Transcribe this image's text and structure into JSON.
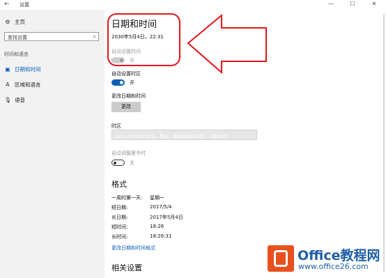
{
  "window": {
    "title": "设置",
    "back_glyph": "←",
    "minimize_glyph": "—",
    "maximize_glyph": "☐",
    "close_glyph": "✕"
  },
  "sidebar": {
    "home": {
      "label": "主页",
      "icon": "gear-icon"
    },
    "search": {
      "placeholder": "查找设置",
      "icon": "search-icon"
    },
    "section": "时间和语言",
    "items": [
      {
        "label": "日期和时间",
        "icon": "calendar-clock-icon",
        "active": true
      },
      {
        "label": "区域和语言",
        "icon": "region-language-icon",
        "active": false
      },
      {
        "label": "语音",
        "icon": "microphone-icon",
        "active": false
      }
    ]
  },
  "main": {
    "title": "日期和时间",
    "datetime": "2030年5月4日，22:31",
    "auto_time": {
      "label": "自动设置时间",
      "state": "开",
      "enabled": false
    },
    "auto_timezone": {
      "label": "自动设置时区",
      "state": "开",
      "on": true
    },
    "change": {
      "label": "更改日期和时间",
      "button": "更改"
    },
    "timezone": {
      "label": "时区",
      "value": "(UTC+08:00) 北京，重庆，香港特别行政区，乌鲁木齐"
    },
    "dst": {
      "label": "自动调整夏令时",
      "state": "关",
      "on": false
    },
    "format": {
      "title": "格式",
      "rows": [
        {
          "label": "一周的第一天:",
          "value": "星期一"
        },
        {
          "label": "短日期:",
          "value": "2017/5/4"
        },
        {
          "label": "长日期:",
          "value": "2017年5月4日"
        },
        {
          "label": "短时间:",
          "value": "18:26"
        },
        {
          "label": "长时间:",
          "value": "18:26:31"
        }
      ],
      "link": "更改日期和时间格式"
    },
    "related": {
      "title": "相关设置"
    }
  },
  "annotation": {
    "color": "#e0151b"
  },
  "watermark": {
    "line1": "Office教程网",
    "line2": "www.office26.com",
    "color": "#1f5fa6",
    "logo_color": "#e8501d"
  }
}
